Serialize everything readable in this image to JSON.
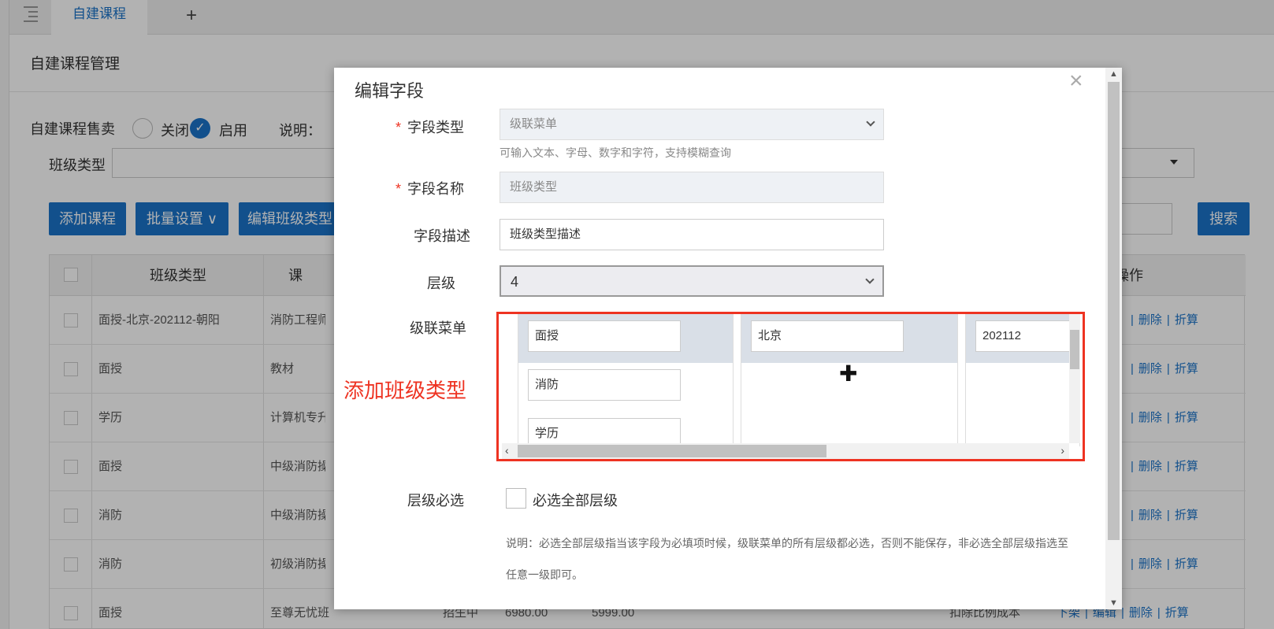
{
  "tabs": {
    "active": "自建课程",
    "add": "+"
  },
  "page": {
    "title": "自建课程管理"
  },
  "sell": {
    "label": "自建课程售卖",
    "off_label": "关闭",
    "on_label": "启用",
    "note_label": "说明："
  },
  "filter": {
    "class_type_label": "班级类型"
  },
  "toolbar": {
    "add_course": "添加课程",
    "batch_settings": "批量设置 ∨",
    "edit_class_type": "编辑班级类型",
    "search": "搜索"
  },
  "table": {
    "headers": {
      "class_type": "班级类型",
      "course": "课",
      "ops": "操作"
    },
    "rows": [
      {
        "class_type": "面授-北京-202112-朝阳",
        "course": "消防工程师"
      },
      {
        "class_type": "面授",
        "course": "教材"
      },
      {
        "class_type": "学历",
        "course": "计算机专升"
      },
      {
        "class_type": "面授",
        "course": "中级消防操"
      },
      {
        "class_type": "消防",
        "course": "中级消防操"
      },
      {
        "class_type": "消防",
        "course": "初级消防操"
      },
      {
        "class_type": "面授",
        "course": "至尊无忧班",
        "status": "招生中",
        "price": "6980.00",
        "sale": "5999.00",
        "cost": "扣除比例成本"
      }
    ],
    "ops": {
      "down": "下架",
      "edit": "编辑",
      "delete": "删除",
      "discount": "折算",
      "sep": "|"
    }
  },
  "modal": {
    "title": "编辑字段",
    "close": "×",
    "field_type_label": "字段类型",
    "field_type_value": "级联菜单",
    "field_type_hint": "可输入文本、字母、数字和字符，支持模糊查询",
    "field_name_label": "字段名称",
    "field_name_value": "班级类型",
    "field_desc_label": "字段描述",
    "field_desc_value": "班级类型描述",
    "level_label": "层级",
    "level_value": "4",
    "cascade_label": "级联菜单",
    "cascade": {
      "col1": [
        "面授",
        "消防",
        "学历"
      ],
      "col2": [
        "北京"
      ],
      "col3": [
        "202112"
      ]
    },
    "required_label": "层级必选",
    "required_check_label": "必选全部层级",
    "explain": "说明：必选全部层级指当该字段为必填项时候，级联菜单的所有层级都必选，否则不能保存，非必选全部层级指选至任意一级即可。"
  },
  "annotation": "添加班级类型",
  "colors": {
    "accent": "#1a73c9",
    "annotation": "#e32222"
  }
}
